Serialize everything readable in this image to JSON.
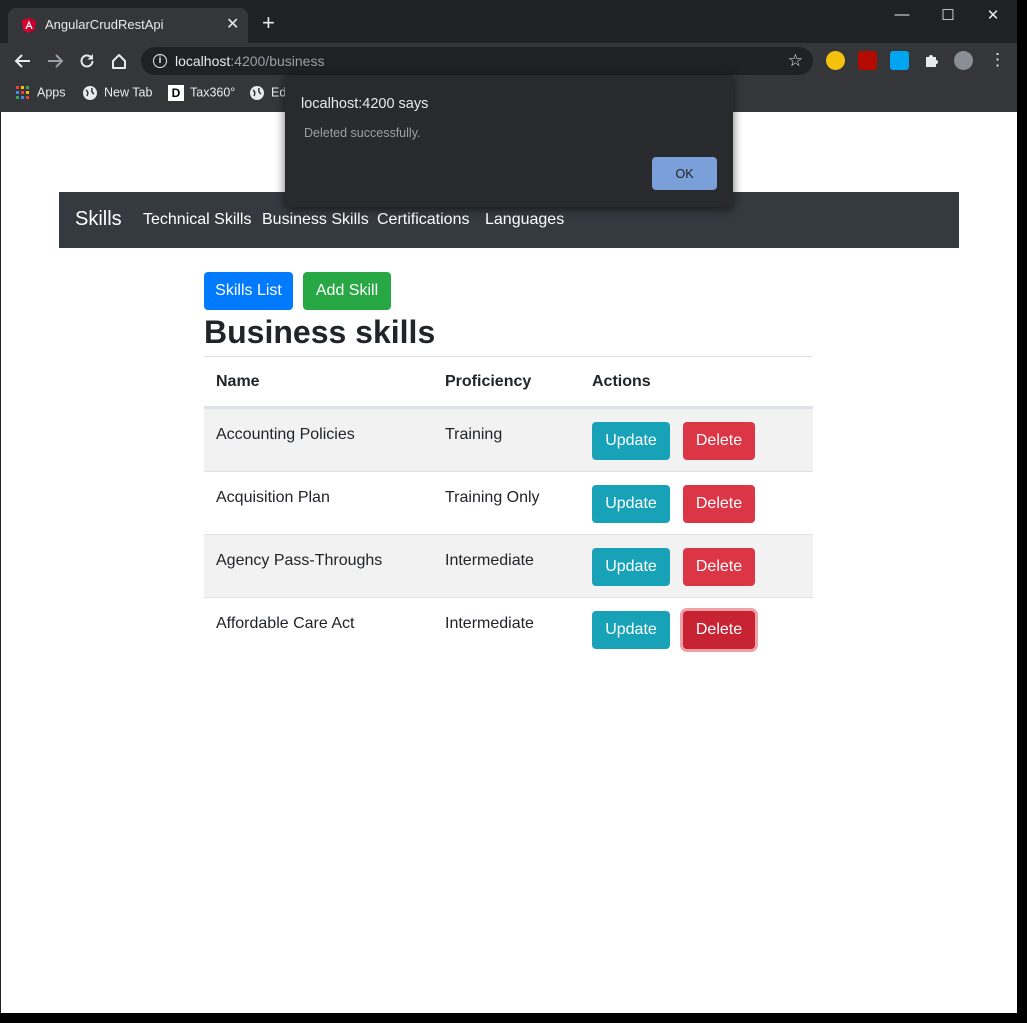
{
  "browser": {
    "tab_title": "AngularCrudRestApi",
    "close_tab_glyph": "✕",
    "new_tab_glyph": "+",
    "window_controls": {
      "minimize": "—",
      "maximize": "☐",
      "close": "✕"
    },
    "url_host": "localhost",
    "url_path": ":4200/business",
    "bookmarks": [
      "Apps",
      "New Tab",
      "Tax360°",
      "Ed"
    ],
    "icons": {
      "back": "back-arrow-icon",
      "forward": "forward-arrow-icon",
      "reload": "reload-icon",
      "home": "home-icon",
      "star": "star-icon"
    }
  },
  "dialog": {
    "title": "localhost:4200 says",
    "message": "Deleted successfully.",
    "ok_label": "OK"
  },
  "navbar": {
    "brand": "Skills",
    "links": [
      "Technical Skills",
      "Business Skills",
      "Certifications",
      "Languages"
    ]
  },
  "actions": {
    "list_label": "Skills List",
    "add_label": "Add Skill"
  },
  "page_title": "Business skills",
  "table": {
    "headers": [
      "Name",
      "Proficiency",
      "Actions"
    ],
    "rows": [
      {
        "name": "Accounting Policies",
        "proficiency": "Training"
      },
      {
        "name": "Acquisition Plan",
        "proficiency": "Training Only"
      },
      {
        "name": "Agency Pass-Throughs",
        "proficiency": "Intermediate"
      },
      {
        "name": "Affordable Care Act",
        "proficiency": "Intermediate"
      }
    ],
    "update_label": "Update",
    "delete_label": "Delete"
  },
  "colors": {
    "primary": "#007bff",
    "success": "#28a745",
    "info": "#17a2b8",
    "danger": "#dc3545",
    "navbar": "#343a40"
  }
}
